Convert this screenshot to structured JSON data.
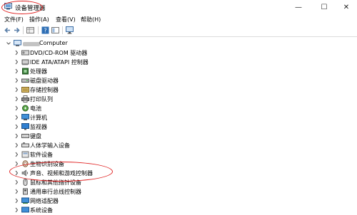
{
  "window": {
    "title": "设备管理器",
    "controls": {
      "minimize": "—",
      "maximize": "☐",
      "close": "✕"
    }
  },
  "menu": [
    "文件(F)",
    "操作(A)",
    "查看(V)",
    "帮助(H)"
  ],
  "toolbar": [
    "back-icon",
    "forward-icon",
    "properties-grid-icon",
    "help-icon",
    "view-panel-icon",
    "monitor-icon"
  ],
  "tree": {
    "root": "Computer",
    "items": [
      "DVD/CD-ROM 驱动器",
      "IDE ATA/ATAPI 控制器",
      "处理器",
      "磁盘驱动器",
      "存储控制器",
      "打印队列",
      "电池",
      "计算机",
      "监视器",
      "键盘",
      "人体学输入设备",
      "软件设备",
      "生物识别设备",
      "声音、视频和游戏控制器",
      "鼠标和其他指针设备",
      "通用串行总线控制器",
      "网络适配器",
      "系统设备"
    ]
  },
  "colors": {
    "annotation": "#e02020",
    "icon_blue": "#2f6fb5"
  }
}
